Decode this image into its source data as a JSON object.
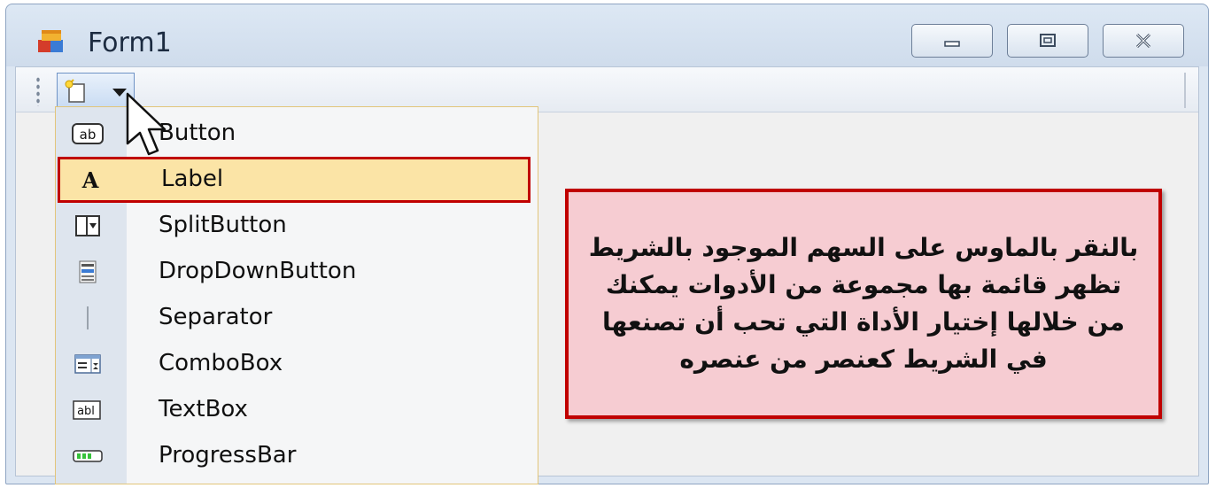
{
  "window": {
    "title": "Form1",
    "controls": [
      "minimize",
      "maximize",
      "close"
    ]
  },
  "toolstrip": {
    "add_button_icon": "new-item-icon",
    "dropdown_icon": "dropdown-arrow-icon"
  },
  "dropdown_menu": {
    "selected": "Label",
    "items": [
      {
        "label": "Button",
        "icon": "button-ab-icon"
      },
      {
        "label": "Label",
        "icon": "label-a-icon"
      },
      {
        "label": "SplitButton",
        "icon": "split-button-icon"
      },
      {
        "label": "DropDownButton",
        "icon": "dropdown-button-icon"
      },
      {
        "label": "Separator",
        "icon": "separator-icon"
      },
      {
        "label": "ComboBox",
        "icon": "combobox-icon"
      },
      {
        "label": "TextBox",
        "icon": "textbox-abl-icon"
      },
      {
        "label": "ProgressBar",
        "icon": "progressbar-icon"
      }
    ]
  },
  "note": {
    "text": "بالنقر بالماوس على السهم الموجود بالشريط تظهر قائمة بها مجموعة من الأدوات يمكنك من خلالها إختيار الأداة التي تحب أن تصنعها في الشريط كعنصر من عنصره"
  },
  "colors": {
    "highlight_border": "#c00000",
    "selected_item_bg": "#fbe4a6",
    "note_bg": "#f6ccd2"
  }
}
